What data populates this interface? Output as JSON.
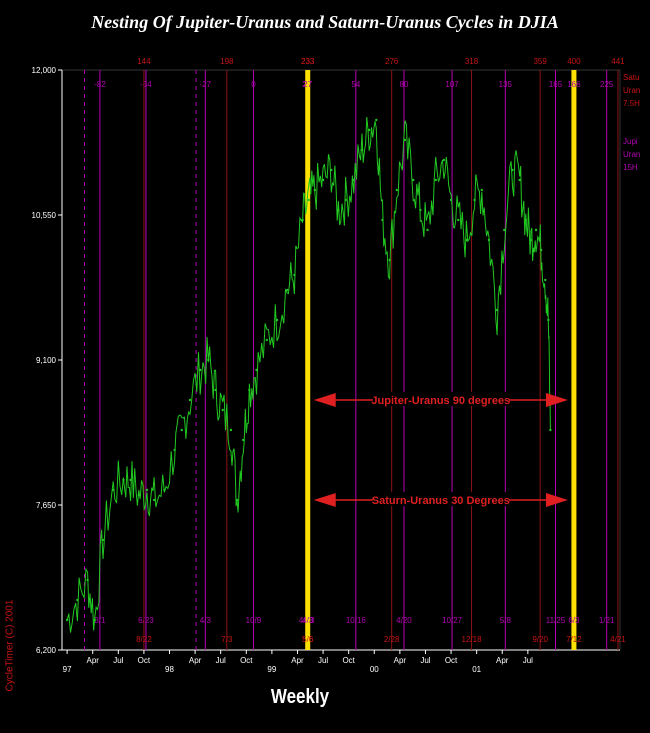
{
  "chart_data": {
    "type": "line",
    "title": "Nesting Of Jupiter-Uranus and Saturn-Uranus Cycles in DJIA",
    "xlabel": "Weekly",
    "copyright": "CycleTimer (C) 2001",
    "ylim": [
      6200,
      12000
    ],
    "y_ticks": [
      "12,000",
      "10,550",
      "9,100",
      "7,650",
      "6,200"
    ],
    "x_ticks": [
      {
        "label": "97",
        "x": 1997.0,
        "row": 1
      },
      {
        "label": "Apr",
        "x": 1997.25,
        "row": 0
      },
      {
        "label": "Jul",
        "x": 1997.5,
        "row": 0
      },
      {
        "label": "Oct",
        "x": 1997.75,
        "row": 0
      },
      {
        "label": "98",
        "x": 1998.0,
        "row": 1
      },
      {
        "label": "Apr",
        "x": 1998.25,
        "row": 0
      },
      {
        "label": "Jul",
        "x": 1998.5,
        "row": 0
      },
      {
        "label": "Oct",
        "x": 1998.75,
        "row": 0
      },
      {
        "label": "99",
        "x": 1999.0,
        "row": 1
      },
      {
        "label": "Apr",
        "x": 1999.25,
        "row": 0
      },
      {
        "label": "Jul",
        "x": 1999.5,
        "row": 0
      },
      {
        "label": "Oct",
        "x": 1999.75,
        "row": 0
      },
      {
        "label": "00",
        "x": 2000.0,
        "row": 1
      },
      {
        "label": "Apr",
        "x": 2000.25,
        "row": 0
      },
      {
        "label": "Jul",
        "x": 2000.5,
        "row": 0
      },
      {
        "label": "Oct",
        "x": 2000.75,
        "row": 0
      },
      {
        "label": "01",
        "x": 2001.0,
        "row": 1
      },
      {
        "label": "Apr",
        "x": 2001.25,
        "row": 0
      },
      {
        "label": "Jul",
        "x": 2001.5,
        "row": 0
      }
    ],
    "xlim": [
      1996.95,
      2002.4
    ],
    "series": [
      {
        "color": "#21c821",
        "x": [
          1997.0,
          1997.1,
          1997.2,
          1997.27,
          1997.35,
          1997.45,
          1997.55,
          1997.62,
          1997.7,
          1997.78,
          1997.85,
          1997.95,
          1998.05,
          1998.12,
          1998.2,
          1998.3,
          1998.38,
          1998.45,
          1998.52,
          1998.6,
          1998.66,
          1998.72,
          1998.78,
          1998.85,
          1998.95,
          1999.05,
          1999.15,
          1999.22,
          1999.3,
          1999.36,
          1999.42,
          1999.5,
          1999.58,
          1999.65,
          1999.72,
          1999.8,
          1999.88,
          1999.95,
          2000.02,
          2000.08,
          2000.15,
          2000.22,
          2000.3,
          2000.38,
          2000.45,
          2000.52,
          2000.6,
          2000.68,
          2000.75,
          2000.82,
          2000.9,
          2000.98,
          2001.05,
          2001.12,
          2001.2,
          2001.27,
          2001.35,
          2001.42,
          2001.48,
          2001.53,
          2001.58,
          2001.63,
          2001.67,
          2001.7,
          2001.72
        ],
        "y": [
          6500,
          6700,
          6900,
          6500,
          7300,
          7800,
          7900,
          7900,
          7750,
          7800,
          7700,
          7800,
          8200,
          8400,
          8700,
          9000,
          9100,
          8800,
          8600,
          8400,
          7700,
          8300,
          8800,
          9000,
          9300,
          9500,
          9800,
          9950,
          10500,
          10700,
          10800,
          10900,
          11000,
          10600,
          10700,
          10900,
          11200,
          11400,
          11500,
          10500,
          10100,
          10800,
          11300,
          10900,
          10600,
          10400,
          10900,
          11100,
          10700,
          10500,
          10300,
          10700,
          10800,
          10300,
          9600,
          10400,
          11000,
          10900,
          10500,
          10300,
          10400,
          10200,
          9900,
          9500,
          8400
        ]
      }
    ],
    "cycle_lines": [
      {
        "name": "Jupiter-Uranus 15H",
        "color": "#b400b4",
        "x": [
          1997.32,
          1997.77,
          1998.35,
          1998.82,
          1999.34,
          1999.82,
          2000.29,
          2000.76,
          2001.28,
          2001.77,
          2002.27
        ],
        "labels": [
          "-82",
          "-54",
          "-27",
          "0",
          "27",
          "54",
          "80",
          "107",
          "135",
          "165",
          "225"
        ],
        "bottom": [
          "3/1",
          "6/23",
          "4/3",
          "10/9",
          "4/23",
          "10/16",
          "4/20",
          "10/27",
          "5/8",
          "11/25",
          "1/21"
        ],
        "style": "solid"
      },
      {
        "name": "Saturn-Uranus 7.5H",
        "color": "#8c1414",
        "x": [
          1997.75,
          1998.56,
          1999.35,
          2000.17,
          2000.95,
          2001.62,
          2002.38
        ],
        "labels": [
          "144",
          "198",
          "233",
          "276",
          "318",
          "359",
          "441"
        ],
        "bottom": [
          "8/22",
          "7/3",
          "5/6",
          "2/28",
          "12/18",
          "9/20",
          "4/21"
        ],
        "style": "solid"
      }
    ],
    "dashed_lines": [
      1997.17,
      1997.77,
      1998.26
    ],
    "highlight_lines": [
      1999.35,
      2001.95
    ],
    "highlight_color": "#ffe000",
    "highlight_top_labels": [
      "233",
      "400"
    ],
    "highlight_bottom_labels": [
      "4/3",
      "6/3"
    ],
    "highlight_bottom_red": [
      "5/6",
      "7/12"
    ],
    "highlight_top_purple": [
      "27",
      "166"
    ],
    "annotations": [
      {
        "text": "Jupiter-Uranus 90 degrees",
        "y": 8700,
        "color": "#e02020"
      },
      {
        "text": "Saturn-Uranus 30 Degrees",
        "y": 7700,
        "color": "#e02020"
      }
    ],
    "right_legend": [
      {
        "lines": [
          "Satu",
          "Uran",
          "7.5H"
        ],
        "color": "#c81414"
      },
      {
        "lines": [
          "Jupi",
          "Uran",
          "15H"
        ],
        "color": "#b400b4"
      }
    ]
  }
}
